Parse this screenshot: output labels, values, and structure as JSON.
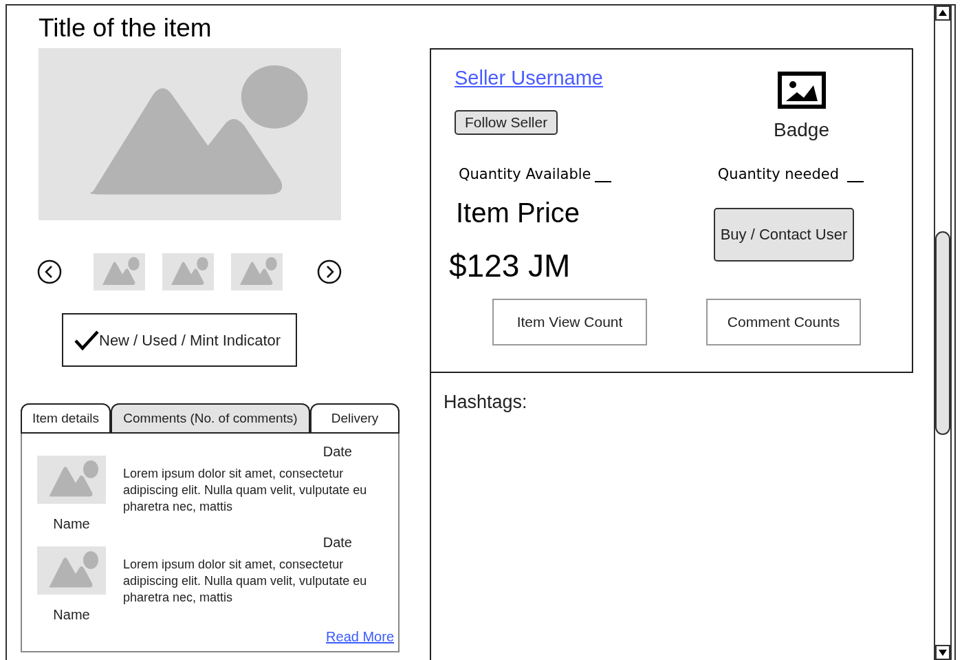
{
  "title": "Title of the item",
  "gallery": {
    "thumbnails": [
      {
        "kind": "picture"
      },
      {
        "kind": "picture"
      },
      {
        "kind": "picture"
      }
    ]
  },
  "condition": {
    "label": "New / Used / Mint Indicator",
    "checked": true
  },
  "tabs": [
    {
      "label": "Item details",
      "selected": false
    },
    {
      "label": "Comments (No. of comments)",
      "selected": true
    },
    {
      "label": "Delivery",
      "selected": false
    }
  ],
  "comments": [
    {
      "date": "Date",
      "text": "Lorem ipsum dolor sit amet, consectetur adipiscing elit. Nulla quam velit, vulputate eu pharetra nec, mattis",
      "name": "Name"
    },
    {
      "date": "Date",
      "text": "Lorem ipsum dolor sit amet, consectetur adipiscing elit. Nulla quam velit, vulputate eu pharetra nec, mattis",
      "name": "Name"
    }
  ],
  "read_more": "Read More",
  "seller": {
    "username": "Seller Username",
    "follow_button": "Follow Seller",
    "badge": "Badge"
  },
  "quantity_available": "Quantity Available",
  "quantity_needed": "Quantity needed",
  "price_label": "Item Price",
  "price": "$123 JM",
  "buy_button": "Buy / Contact User",
  "stats": [
    "Item View Count",
    "Comment Counts"
  ],
  "hashtags_label": "Hashtags:"
}
